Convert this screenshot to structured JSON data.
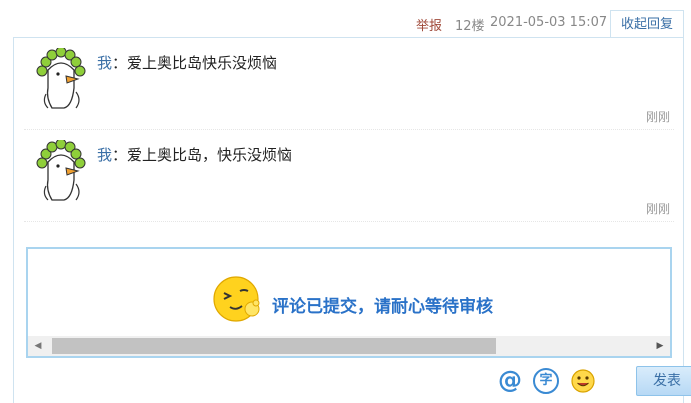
{
  "post_meta": {
    "report_label": "举报",
    "floor_label": "12楼",
    "timestamp": "2021-05-03 15:07",
    "collapse_label": "收起回复"
  },
  "replies": [
    {
      "author": "我",
      "separator": "：",
      "content": "爱上奥比岛快乐没烦恼",
      "time": "刚刚"
    },
    {
      "author": "我",
      "separator": "：",
      "content": "爱上奥比岛，快乐没烦恼",
      "time": "刚刚"
    }
  ],
  "editor": {
    "toast_message": "评论已提交，请耐心等待审核"
  },
  "toolbar": {
    "at_label": "@",
    "font_label": "字",
    "submit_label": "发表"
  },
  "colors": {
    "link_blue": "#3a6fa6",
    "toast_blue": "#2a72c8",
    "report_red": "#a04a3a",
    "panel_border": "#cfe3f0"
  },
  "icons": [
    "goose-avatar-icon",
    "wink-face-icon",
    "at-icon",
    "font-icon",
    "smiley-icon",
    "arrow-left-icon",
    "arrow-right-icon"
  ]
}
